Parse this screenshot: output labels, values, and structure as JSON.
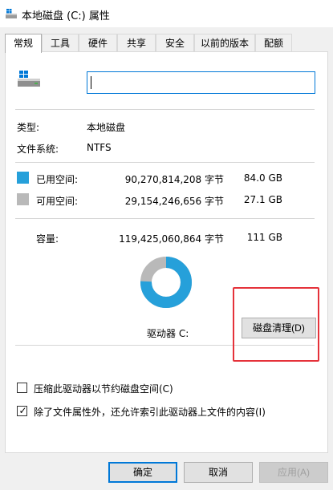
{
  "window": {
    "title": "本地磁盘 (C:) 属性",
    "icon": "drive-icon"
  },
  "tabs": [
    {
      "label": "常规",
      "active": true
    },
    {
      "label": "工具"
    },
    {
      "label": "硬件"
    },
    {
      "label": "共享"
    },
    {
      "label": "安全"
    },
    {
      "label": "以前的版本"
    },
    {
      "label": "配额"
    }
  ],
  "general": {
    "name_value": "",
    "type_label": "类型:",
    "type_value": "本地磁盘",
    "fs_label": "文件系统:",
    "fs_value": "NTFS",
    "used": {
      "label": "已用空间:",
      "bytes": "90,270,814,208 字节",
      "size": "84.0 GB",
      "color": "#26a0da"
    },
    "free": {
      "label": "可用空间:",
      "bytes": "29,154,246,656 字节",
      "size": "27.1 GB",
      "color": "#b9b9b9"
    },
    "capacity": {
      "label": "容量:",
      "bytes": "119,425,060,864 字节",
      "size": "111 GB"
    },
    "used_fraction": 0.7559,
    "drive_label": "驱动器 C:",
    "cleanup_button": "磁盘清理(D)",
    "compress": {
      "label": "压缩此驱动器以节约磁盘空间(C)",
      "checked": false
    },
    "index": {
      "label": "除了文件属性外，还允许索引此驱动器上文件的内容(I)",
      "checked": true
    }
  },
  "footer": {
    "ok": "确定",
    "cancel": "取消",
    "apply": "应用(A)"
  },
  "colors": {
    "accent": "#0078d7",
    "highlight": "#e5323a"
  }
}
